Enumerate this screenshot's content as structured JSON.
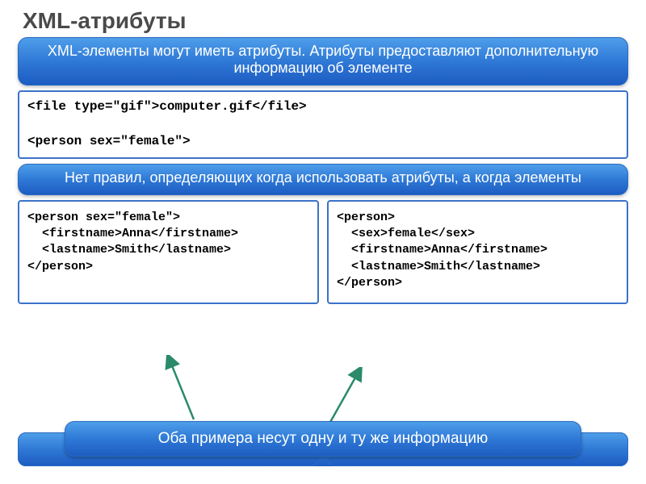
{
  "title": "XML-атрибуты",
  "callout1": "XML-элементы могут иметь атрибуты. Атрибуты предоставляют дополнительную информацию об элементе",
  "code1": "<file type=\"gif\">computer.gif</file>\n\n<person sex=\"female\">",
  "callout2": "Нет правил, определяющих когда использовать атрибуты, а когда элементы",
  "code_left": "<person sex=\"female\">\n  <firstname>Anna</firstname>\n  <lastname>Smith</lastname>\n</person>",
  "code_right": "<person>\n  <sex>female</sex>\n  <firstname>Anna</firstname>\n  <lastname>Smith</lastname>\n</person>",
  "callout3": "Оба примера несут одну и ту же информацию"
}
